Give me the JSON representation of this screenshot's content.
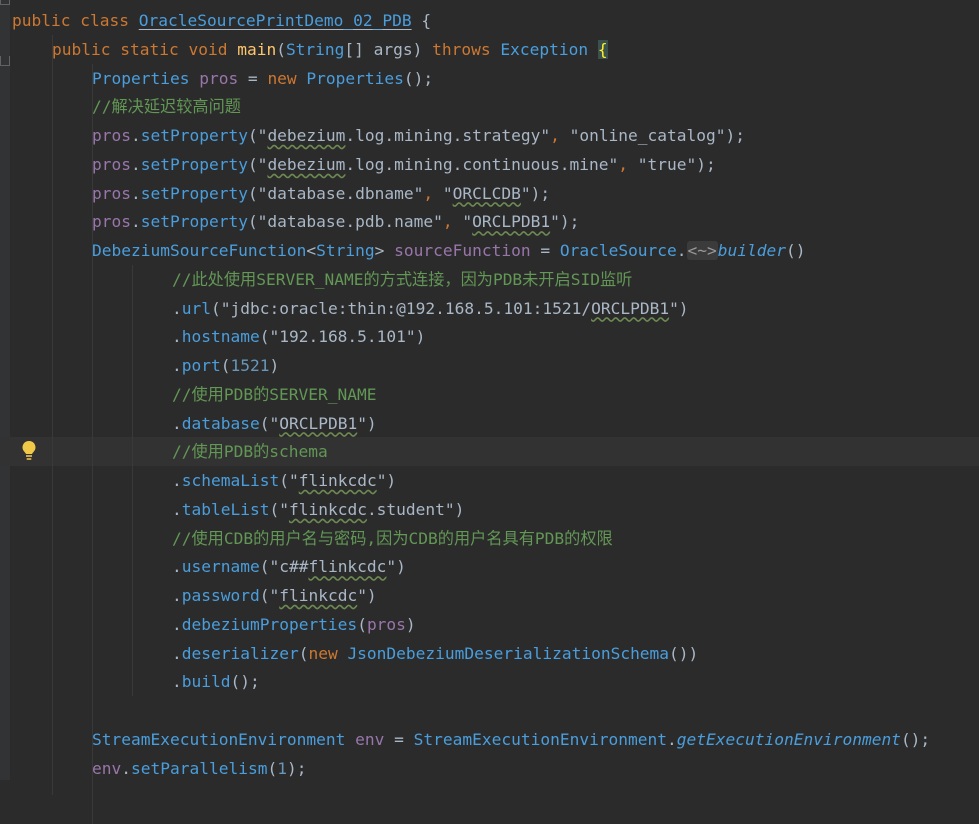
{
  "editor": {
    "lines": [
      {
        "indent": 0,
        "tokens": [
          {
            "t": "public ",
            "c": "kw"
          },
          {
            "t": "class ",
            "c": "kw"
          },
          {
            "t": "OracleSourcePrintDemo_02_PDB",
            "c": "cls uline2"
          },
          {
            "t": " {",
            "c": "plain"
          }
        ]
      },
      {
        "indent": 1,
        "tokens": [
          {
            "t": "public ",
            "c": "kw"
          },
          {
            "t": "static ",
            "c": "kw"
          },
          {
            "t": "void ",
            "c": "kw"
          },
          {
            "t": "main",
            "c": "fn"
          },
          {
            "t": "(",
            "c": "plain"
          },
          {
            "t": "String",
            "c": "cls"
          },
          {
            "t": "[] args) ",
            "c": "plain"
          },
          {
            "t": "throws ",
            "c": "kw"
          },
          {
            "t": "Exception ",
            "c": "cls"
          },
          {
            "t": "{",
            "c": "bracehl"
          }
        ]
      },
      {
        "indent": 2,
        "tokens": [
          {
            "t": "Properties ",
            "c": "cls"
          },
          {
            "t": "pros",
            "c": "var"
          },
          {
            "t": " = ",
            "c": "plain"
          },
          {
            "t": "new ",
            "c": "kw"
          },
          {
            "t": "Properties",
            "c": "cls"
          },
          {
            "t": "();",
            "c": "plain"
          }
        ]
      },
      {
        "indent": 2,
        "tokens": [
          {
            "t": "//解决延迟较高问题",
            "c": "cm"
          }
        ]
      },
      {
        "indent": 2,
        "tokens": [
          {
            "t": "pros",
            "c": "var"
          },
          {
            "t": ".",
            "c": "plain"
          },
          {
            "t": "setProperty",
            "c": "cls"
          },
          {
            "t": "(\"",
            "c": "plain"
          },
          {
            "t": "debezium",
            "c": "plain uline"
          },
          {
            "t": ".log.mining.strategy\"",
            "c": "plain"
          },
          {
            "t": ", ",
            "c": "kw"
          },
          {
            "t": "\"online_catalog\"",
            "c": "plain"
          },
          {
            "t": ");",
            "c": "plain"
          }
        ]
      },
      {
        "indent": 2,
        "tokens": [
          {
            "t": "pros",
            "c": "var"
          },
          {
            "t": ".",
            "c": "plain"
          },
          {
            "t": "setProperty",
            "c": "cls"
          },
          {
            "t": "(\"",
            "c": "plain"
          },
          {
            "t": "debezium",
            "c": "plain uline"
          },
          {
            "t": ".log.mining.continuous.mine\"",
            "c": "plain"
          },
          {
            "t": ", ",
            "c": "kw"
          },
          {
            "t": "\"true\"",
            "c": "plain"
          },
          {
            "t": ");",
            "c": "plain"
          }
        ]
      },
      {
        "indent": 2,
        "tokens": [
          {
            "t": "pros",
            "c": "var"
          },
          {
            "t": ".",
            "c": "plain"
          },
          {
            "t": "setProperty",
            "c": "cls"
          },
          {
            "t": "(\"database.dbname\"",
            "c": "plain"
          },
          {
            "t": ", ",
            "c": "kw"
          },
          {
            "t": "\"",
            "c": "plain"
          },
          {
            "t": "ORCLCDB",
            "c": "plain uline"
          },
          {
            "t": "\");",
            "c": "plain"
          }
        ]
      },
      {
        "indent": 2,
        "tokens": [
          {
            "t": "pros",
            "c": "var"
          },
          {
            "t": ".",
            "c": "plain"
          },
          {
            "t": "setProperty",
            "c": "cls"
          },
          {
            "t": "(\"database.pdb.name\"",
            "c": "plain"
          },
          {
            "t": ", ",
            "c": "kw"
          },
          {
            "t": "\"",
            "c": "plain"
          },
          {
            "t": "ORCLPDB1",
            "c": "plain uline"
          },
          {
            "t": "\");",
            "c": "plain"
          }
        ]
      },
      {
        "indent": 2,
        "tokens": [
          {
            "t": "DebeziumSourceFunction",
            "c": "cls"
          },
          {
            "t": "<",
            "c": "plain"
          },
          {
            "t": "String",
            "c": "cls"
          },
          {
            "t": "> ",
            "c": "plain"
          },
          {
            "t": "sourceFunction",
            "c": "var"
          },
          {
            "t": " = ",
            "c": "plain"
          },
          {
            "t": "OracleSource",
            "c": "cls"
          },
          {
            "t": ".",
            "c": "plain"
          },
          {
            "t": "<~>",
            "c": "hint"
          },
          {
            "t": "builder",
            "c": "cls it"
          },
          {
            "t": "()",
            "c": "plain"
          }
        ]
      },
      {
        "indent": 4,
        "tokens": [
          {
            "t": "//此处使用SERVER_NAME的方式连接，因为PDB未开启SID监听",
            "c": "cm"
          }
        ]
      },
      {
        "indent": 4,
        "tokens": [
          {
            "t": ".",
            "c": "plain"
          },
          {
            "t": "url",
            "c": "cls"
          },
          {
            "t": "(\"jdbc:oracle:thin:@192.168.5.101:1521/",
            "c": "plain"
          },
          {
            "t": "ORCLPDB1",
            "c": "plain uline"
          },
          {
            "t": "\")",
            "c": "plain"
          }
        ]
      },
      {
        "indent": 4,
        "tokens": [
          {
            "t": ".",
            "c": "plain"
          },
          {
            "t": "hostname",
            "c": "cls"
          },
          {
            "t": "(\"192.168.5.101\")",
            "c": "plain"
          }
        ]
      },
      {
        "indent": 4,
        "tokens": [
          {
            "t": ".",
            "c": "plain"
          },
          {
            "t": "port",
            "c": "cls"
          },
          {
            "t": "(",
            "c": "plain"
          },
          {
            "t": "1521",
            "c": "num"
          },
          {
            "t": ")",
            "c": "plain"
          }
        ]
      },
      {
        "indent": 4,
        "tokens": [
          {
            "t": "//使用PDB的SERVER_NAME",
            "c": "cm"
          }
        ]
      },
      {
        "indent": 4,
        "tokens": [
          {
            "t": ".",
            "c": "plain"
          },
          {
            "t": "database",
            "c": "cls"
          },
          {
            "t": "(\"",
            "c": "plain"
          },
          {
            "t": "ORCLPDB1",
            "c": "plain uline"
          },
          {
            "t": "\")",
            "c": "plain"
          }
        ]
      },
      {
        "indent": 4,
        "hl": true,
        "tokens": [
          {
            "t": "//使用PDB的schema",
            "c": "cm"
          }
        ]
      },
      {
        "indent": 4,
        "tokens": [
          {
            "t": ".",
            "c": "plain"
          },
          {
            "t": "schemaList",
            "c": "cls"
          },
          {
            "t": "(\"",
            "c": "plain"
          },
          {
            "t": "flinkcdc",
            "c": "plain uline"
          },
          {
            "t": "\")",
            "c": "plain"
          }
        ]
      },
      {
        "indent": 4,
        "tokens": [
          {
            "t": ".",
            "c": "plain"
          },
          {
            "t": "tableList",
            "c": "cls"
          },
          {
            "t": "(\"",
            "c": "plain"
          },
          {
            "t": "flinkcdc",
            "c": "plain uline"
          },
          {
            "t": ".student\")",
            "c": "plain"
          }
        ]
      },
      {
        "indent": 4,
        "tokens": [
          {
            "t": "//使用CDB的用户名与密码,因为CDB的用户名具有PDB的权限",
            "c": "cm"
          }
        ]
      },
      {
        "indent": 4,
        "tokens": [
          {
            "t": ".",
            "c": "plain"
          },
          {
            "t": "username",
            "c": "cls"
          },
          {
            "t": "(\"c##",
            "c": "plain"
          },
          {
            "t": "flinkcdc",
            "c": "plain uline"
          },
          {
            "t": "\")",
            "c": "plain"
          }
        ]
      },
      {
        "indent": 4,
        "tokens": [
          {
            "t": ".",
            "c": "plain"
          },
          {
            "t": "password",
            "c": "cls"
          },
          {
            "t": "(\"",
            "c": "plain"
          },
          {
            "t": "flinkcdc",
            "c": "plain uline"
          },
          {
            "t": "\")",
            "c": "plain"
          }
        ]
      },
      {
        "indent": 4,
        "tokens": [
          {
            "t": ".",
            "c": "plain"
          },
          {
            "t": "debeziumProperties",
            "c": "cls"
          },
          {
            "t": "(",
            "c": "plain"
          },
          {
            "t": "pros",
            "c": "var"
          },
          {
            "t": ")",
            "c": "plain"
          }
        ]
      },
      {
        "indent": 4,
        "tokens": [
          {
            "t": ".",
            "c": "plain"
          },
          {
            "t": "deserializer",
            "c": "cls"
          },
          {
            "t": "(",
            "c": "plain"
          },
          {
            "t": "new ",
            "c": "kw"
          },
          {
            "t": "JsonDebeziumDeserializationSchema",
            "c": "cls"
          },
          {
            "t": "())",
            "c": "plain"
          }
        ]
      },
      {
        "indent": 4,
        "tokens": [
          {
            "t": ".",
            "c": "plain"
          },
          {
            "t": "build",
            "c": "cls"
          },
          {
            "t": "();",
            "c": "plain"
          }
        ]
      },
      {
        "indent": 0,
        "tokens": []
      },
      {
        "indent": 2,
        "tokens": [
          {
            "t": "StreamExecutionEnvironment ",
            "c": "cls"
          },
          {
            "t": "env",
            "c": "var"
          },
          {
            "t": " = ",
            "c": "plain"
          },
          {
            "t": "StreamExecutionEnvironment",
            "c": "cls"
          },
          {
            "t": ".",
            "c": "plain"
          },
          {
            "t": "getExecutionEnvironment",
            "c": "cls it"
          },
          {
            "t": "();",
            "c": "plain"
          }
        ]
      },
      {
        "indent": 2,
        "tokens": [
          {
            "t": "env",
            "c": "var"
          },
          {
            "t": ".",
            "c": "plain"
          },
          {
            "t": "setParallelism",
            "c": "cls"
          },
          {
            "t": "(",
            "c": "plain"
          },
          {
            "t": "1",
            "c": "num"
          },
          {
            "t": ");",
            "c": "plain"
          }
        ]
      }
    ],
    "intention_icon": "lightbulb-icon"
  }
}
